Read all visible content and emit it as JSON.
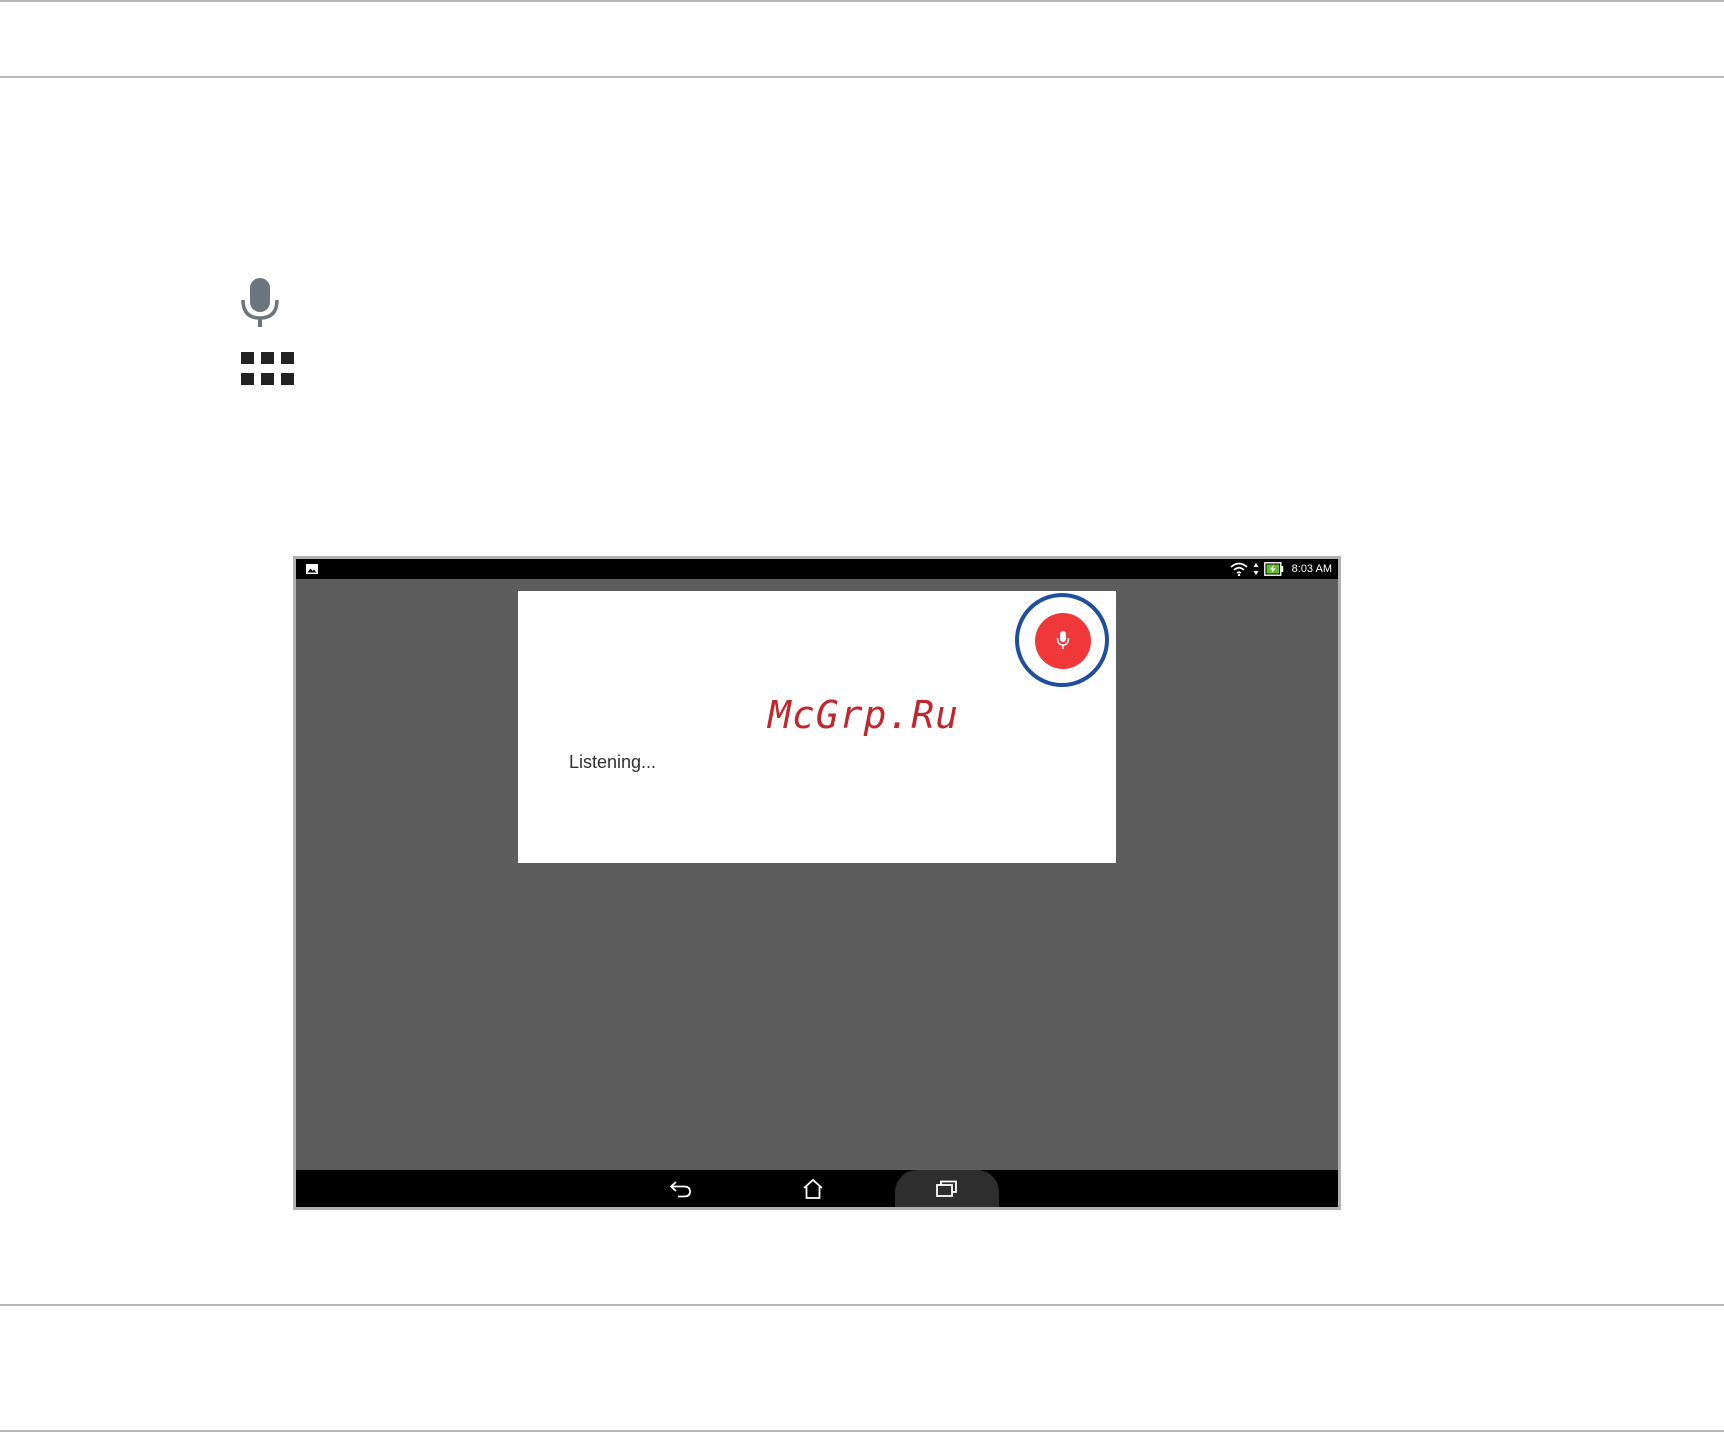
{
  "sidebar": {
    "icons": [
      {
        "name": "microphone-icon",
        "color": "#6b7580"
      },
      {
        "name": "app-grid-icon",
        "color": "#222222"
      }
    ]
  },
  "device": {
    "status_bar": {
      "time": "8:03 AM",
      "icons": [
        "notification-image-icon",
        "wifi-icon",
        "data-arrows-icon",
        "battery-charging-icon"
      ]
    },
    "voice_dialog": {
      "status_text": "Listening...",
      "mic_button_color": "#f0373a",
      "highlight_ring_color": "#1f4e9c"
    },
    "watermark": "McGrp.Ru",
    "nav_bar": {
      "buttons": [
        "back",
        "home",
        "recent-apps"
      ]
    }
  }
}
